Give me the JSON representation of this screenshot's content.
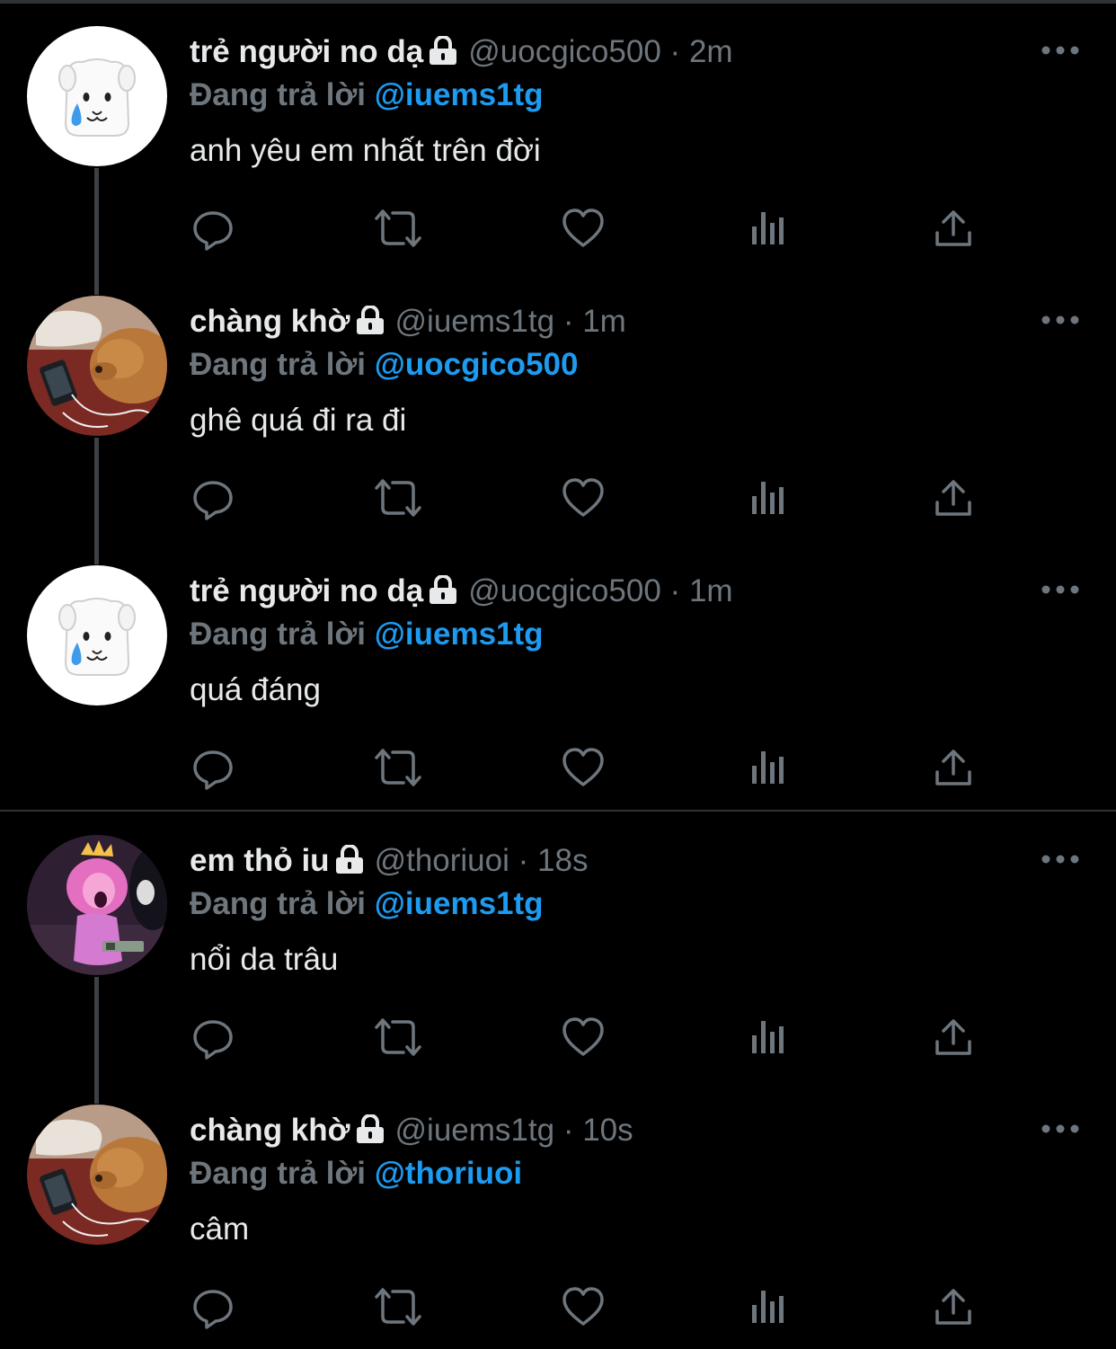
{
  "colors": {
    "background": "#000000",
    "text": "#e7e9ea",
    "secondary": "#6e767d",
    "link": "#1d9bf0",
    "divider": "#2f3336"
  },
  "reply_prefix": "Đang trả lời",
  "icons": {
    "reply": "reply-icon",
    "retweet": "retweet-icon",
    "like": "like-icon",
    "views": "views-icon",
    "share": "share-icon",
    "more": "more-icon",
    "lock": "lock-icon"
  },
  "tweets": [
    {
      "name": "trẻ người no dạ",
      "handle": "@uocgico500",
      "separator": "·",
      "time": "2m",
      "replying_to": "@iuems1tg",
      "text": "anh yêu em nhất trên đời",
      "avatar": "white-dog-crying-emoji"
    },
    {
      "name": "chàng khờ",
      "handle": "@iuems1tg",
      "separator": "·",
      "time": "1m",
      "replying_to": "@uocgico500",
      "text": "ghê quá đi ra đi",
      "avatar": "sleeping-golden-dog-photo"
    },
    {
      "name": "trẻ người no dạ",
      "handle": "@uocgico500",
      "separator": "·",
      "time": "1m",
      "replying_to": "@iuems1tg",
      "text": "quá đáng",
      "avatar": "white-dog-crying-emoji"
    },
    {
      "name": "em thỏ iu",
      "handle": "@thoriuoi",
      "separator": "·",
      "time": "18s",
      "replying_to": "@iuems1tg",
      "text": "nổi da trâu",
      "avatar": "cartoon-princess-art"
    },
    {
      "name": "chàng khờ",
      "handle": "@iuems1tg",
      "separator": "·",
      "time": "10s",
      "replying_to": "@thoriuoi",
      "text": "câm",
      "avatar": "sleeping-golden-dog-photo"
    }
  ]
}
